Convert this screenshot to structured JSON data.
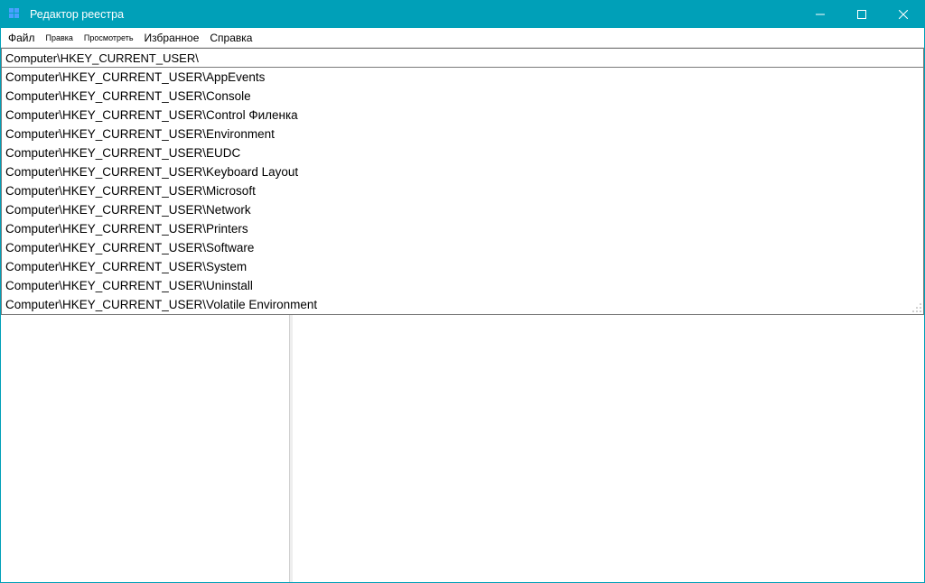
{
  "window": {
    "title": "Редактор реестра"
  },
  "menu": {
    "file": "Файл",
    "edit": "Правка",
    "view": "Просмотреть",
    "favorites": "Избранное",
    "help": "Справка"
  },
  "address": {
    "value": "Computer\\HKEY_CURRENT_USER\\"
  },
  "suggestions": [
    "Computer\\HKEY_CURRENT_USER\\AppEvents",
    "Computer\\HKEY_CURRENT_USER\\Console",
    "Computer\\HKEY_CURRENT_USER\\Control Филенка",
    "Computer\\HKEY_CURRENT_USER\\Environment",
    "Computer\\HKEY_CURRENT_USER\\EUDC",
    "Computer\\HKEY_CURRENT_USER\\Keyboard Layout",
    "Computer\\HKEY_CURRENT_USER\\Microsoft",
    "Computer\\HKEY_CURRENT_USER\\Network",
    "Computer\\HKEY_CURRENT_USER\\Printers",
    "Computer\\HKEY_CURRENT_USER\\Software",
    "Computer\\HKEY_CURRENT_USER\\System",
    "Computer\\HKEY_CURRENT_USER\\Uninstall",
    "Computer\\HKEY_CURRENT_USER\\Volatile Environment"
  ],
  "colors": {
    "titlebar": "#00a0b8"
  }
}
